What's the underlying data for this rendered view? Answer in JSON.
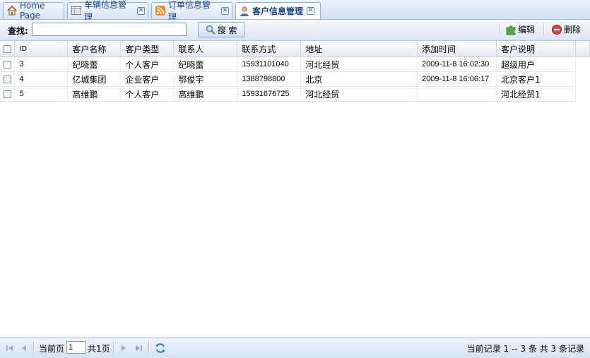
{
  "tabs": [
    {
      "label": "Home Page",
      "icon": "home-icon",
      "closable": false
    },
    {
      "label": "车辆信息管理",
      "icon": "table-icon",
      "closable": true
    },
    {
      "label": "订单信息管理",
      "icon": "rss-icon",
      "closable": true
    },
    {
      "label": "客户信息管理",
      "icon": "user-icon",
      "closable": true,
      "active": true
    }
  ],
  "toolbar": {
    "search_label": "查找:",
    "search_value": "",
    "search_button": "搜 索",
    "edit_button": "编辑",
    "delete_button": "删除"
  },
  "grid": {
    "columns": [
      "ID",
      "客户名称",
      "客户类型",
      "联系人",
      "联系方式",
      "地址",
      "添加时间",
      "客户说明"
    ],
    "rows": [
      {
        "id": "3",
        "name": "纪晓蕾",
        "type": "个人客户",
        "contact": "纪晓蕾",
        "phone": "15931101040",
        "address": "河北经贸",
        "added": "2009-11-8 16:02:30",
        "note": "超级用户"
      },
      {
        "id": "4",
        "name": "亿城集团",
        "type": "企业客户",
        "contact": "鄂俊宇",
        "phone": "1388798800",
        "address": "北京",
        "added": "2009-11-8 16:06:17",
        "note": "北京客户1"
      },
      {
        "id": "5",
        "name": "高维鹏",
        "type": "个人客户",
        "contact": "高维鹏",
        "phone": "15931676725",
        "address": "河北经贸",
        "added": "",
        "note": "河北经贸1"
      }
    ]
  },
  "pager": {
    "current_label": "当前页",
    "page_value": "1",
    "total_pages": "共1页",
    "record_info": "当前记录  1 -- 3 条  共  3 条记录"
  },
  "colors": {
    "accent": "#15428b",
    "tab_border": "#8db2e3",
    "header_bg": "#e3eaf3"
  }
}
